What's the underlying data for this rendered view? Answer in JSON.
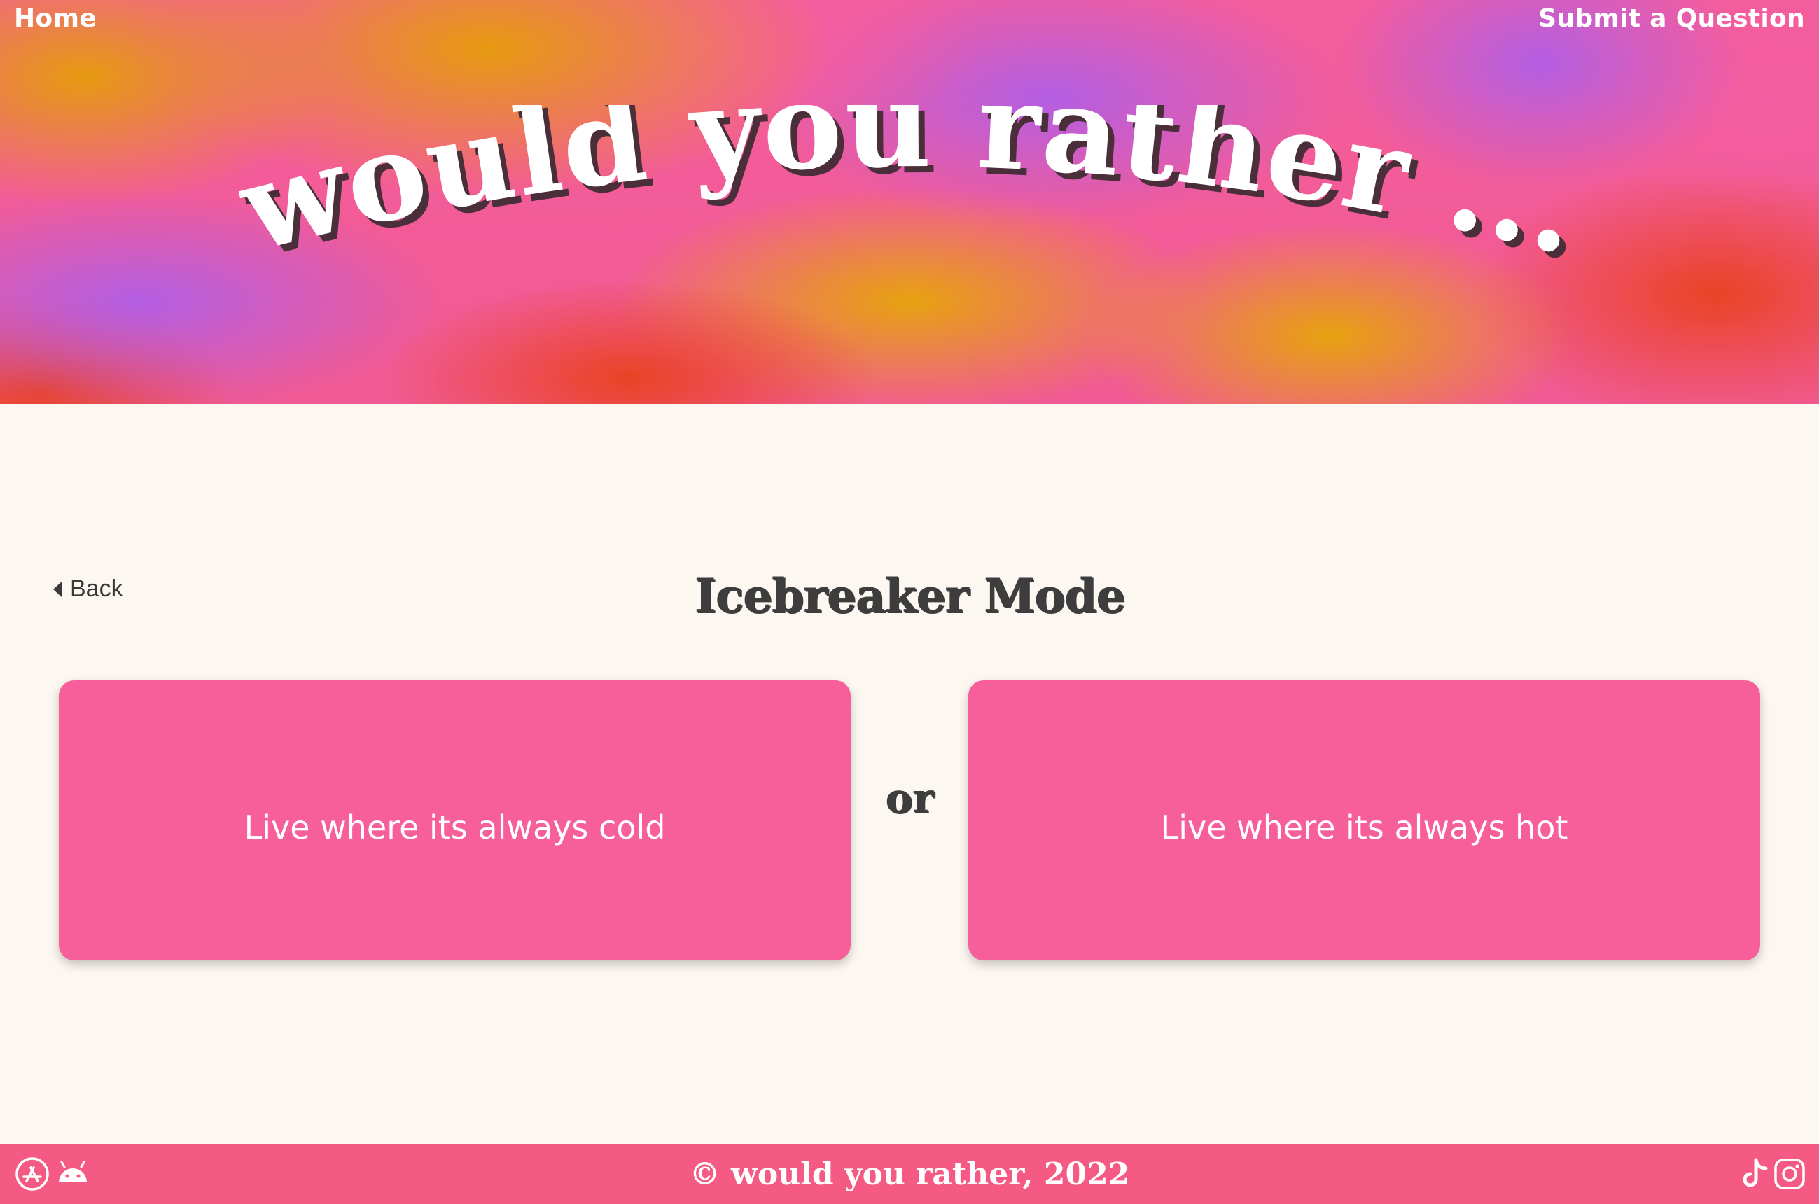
{
  "header": {
    "home_label": "Home",
    "submit_label": "Submit a Question",
    "hero_title": "would you rather ..."
  },
  "main": {
    "back_label": "Back",
    "mode_title": "Icebreaker Mode",
    "option_a": "Live where its always cold",
    "or_label": "or",
    "option_b": "Live where its always hot"
  },
  "footer": {
    "copyright": "© would you rather, 2022",
    "left_icons": [
      "app-store-icon",
      "android-icon"
    ],
    "right_icons": [
      "tiktok-icon",
      "instagram-icon"
    ]
  },
  "colors": {
    "background": "#fdf7f1",
    "card": "#f75f9a",
    "footer": "#f45a84",
    "text_dark": "#3d3d3d",
    "white": "#ffffff"
  }
}
